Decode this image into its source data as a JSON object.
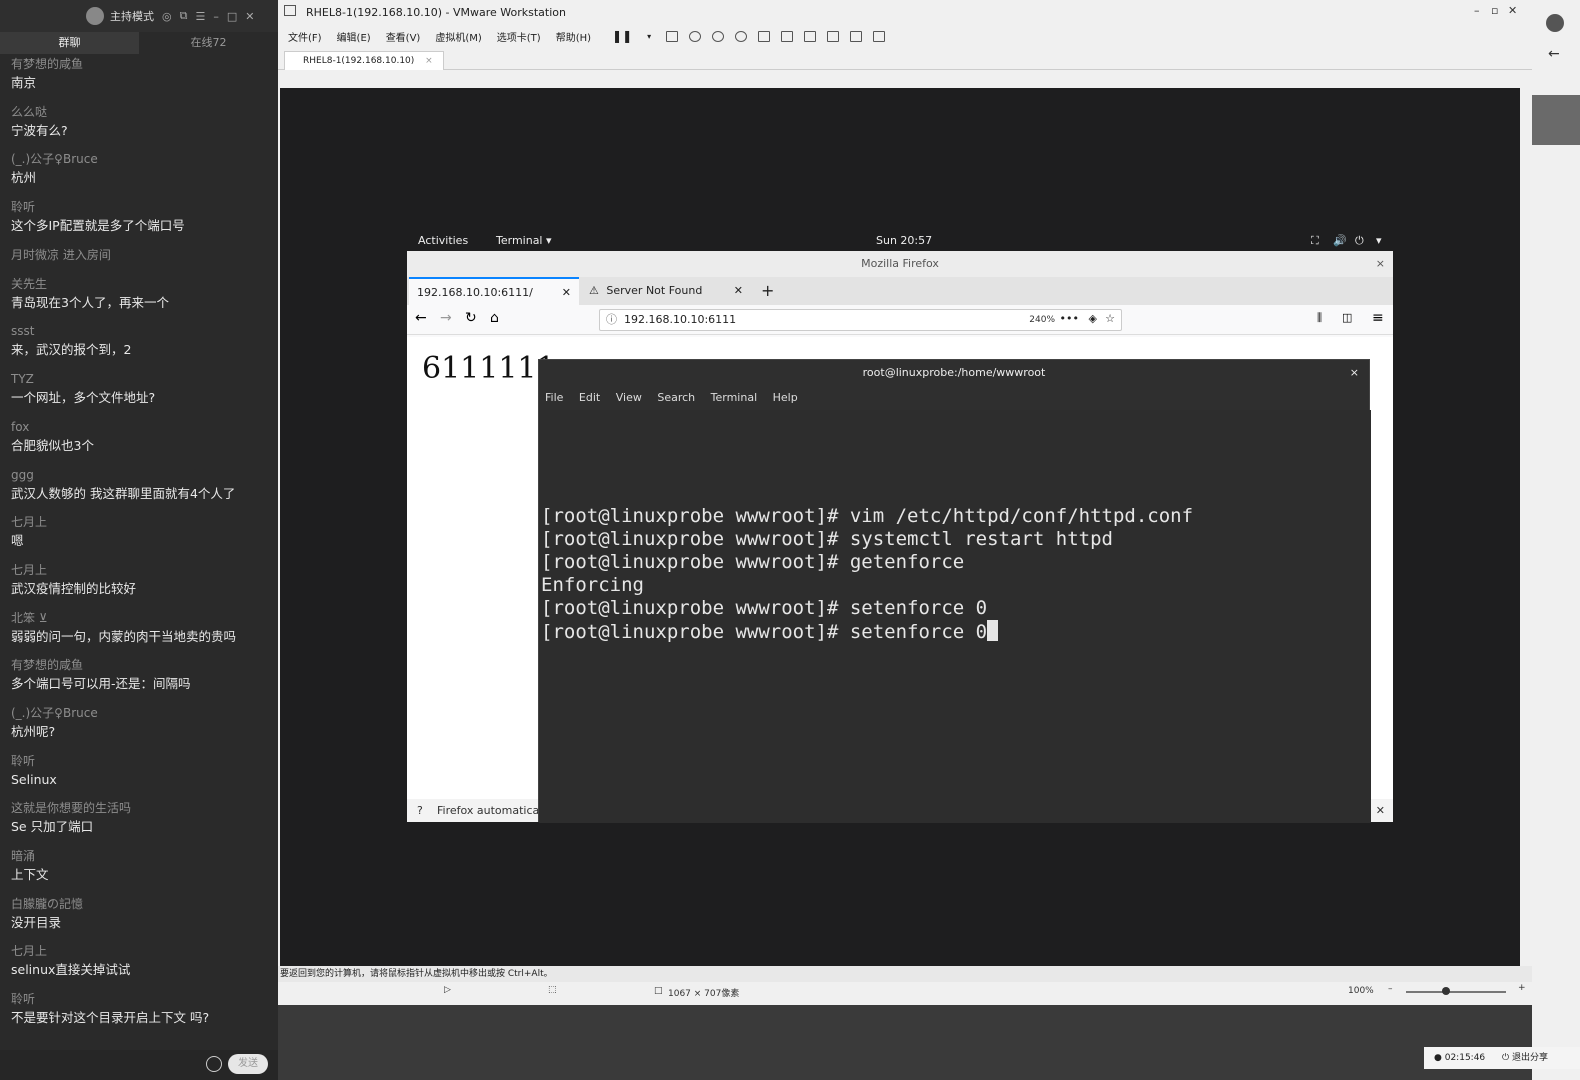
{
  "chat": {
    "title": "主持模式",
    "tabs": [
      "群聊",
      "在线72"
    ],
    "messages": [
      {
        "user": "有梦想的咸鱼",
        "text": "南京"
      },
      {
        "user": "么么哒",
        "text": "宁波有么?"
      },
      {
        "user": "(_.)公子♀Bruce",
        "text": "杭州"
      },
      {
        "user": "聆听",
        "text": "这个多IP配置就是多了个端口号"
      },
      {
        "user": "月时微凉 进入房间",
        "text": ""
      },
      {
        "user": "关先生",
        "text": "青岛现在3个人了，再来一个"
      },
      {
        "user": "ssst",
        "text": "来，武汉的报个到，2"
      },
      {
        "user": "TYZ",
        "text": "一个网址，多个文件地址?"
      },
      {
        "user": "fox",
        "text": "合肥貌似也3个"
      },
      {
        "user": "ggg",
        "text": "武汉人数够的  我这群聊里面就有4个人了"
      },
      {
        "user": "七月上",
        "text": "嗯"
      },
      {
        "user": "七月上",
        "text": "武汉疫情控制的比较好"
      },
      {
        "user": "北笨 ⊻",
        "text": "弱弱的问一句，内蒙的肉干当地卖的贵吗"
      },
      {
        "user": "有梦想的咸鱼",
        "text": "多个端口号可以用-还是：间隔吗"
      },
      {
        "user": "(_.)公子♀Bruce",
        "text": "杭州呢?"
      },
      {
        "user": "聆听",
        "text": "Selinux"
      },
      {
        "user": "这就是你想要的生活吗",
        "text": "Se 只加了端口"
      },
      {
        "user": "暗涌",
        "text": "上下文"
      },
      {
        "user": "白朦朧の記憶",
        "text": "没开目录"
      },
      {
        "user": "七月上",
        "text": "selinux直接关掉试试"
      },
      {
        "user": "聆听",
        "text": "不是要针对这个目录开启上下文 吗?"
      }
    ],
    "send_label": "发送"
  },
  "vmware": {
    "title": "RHEL8-1(192.168.10.10) - VMware Workstation",
    "menu": [
      "文件(F)",
      "编辑(E)",
      "查看(V)",
      "虚拟机(M)",
      "选项卡(T)",
      "帮助(H)"
    ],
    "tab": "RHEL8-1(192.168.10.10)",
    "status_text": "要返回到您的计算机，请将鼠标指针从虚拟机中移出或按 Ctrl+Alt。",
    "resolution": "1067 × 707像素",
    "zoom": "100%"
  },
  "gnome": {
    "activities": "Activities",
    "app_menu": "Terminal ▾",
    "clock": "Sun 20:57"
  },
  "firefox": {
    "window_title": "Mozilla Firefox",
    "tabs": [
      "192.168.10.10:6111/",
      "Server Not Found"
    ],
    "url": "192.168.10.10:6111",
    "zoom": "240%",
    "page_text": "6111111",
    "footer": "Firefox automatically"
  },
  "terminal": {
    "title": "root@linuxprobe:/home/wwwroot",
    "menu": [
      "File",
      "Edit",
      "View",
      "Search",
      "Terminal",
      "Help"
    ],
    "lines": [
      "[root@linuxprobe wwwroot]# vim /etc/httpd/conf/httpd.conf",
      "[root@linuxprobe wwwroot]# systemctl restart httpd",
      "[root@linuxprobe wwwroot]# getenforce",
      "Enforcing",
      "[root@linuxprobe wwwroot]# setenforce 0",
      "[root@linuxprobe wwwroot]# setenforce 0"
    ]
  },
  "taskbar": {
    "time": "02:15:46",
    "share_label": "退出分享"
  }
}
